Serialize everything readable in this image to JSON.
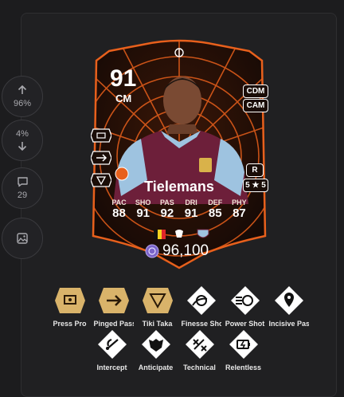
{
  "sidebar": {
    "upvote": {
      "icon": "arrow-up-icon",
      "value": "96%"
    },
    "downvote": {
      "icon": "arrow-down-icon",
      "value": "4%"
    },
    "comments": {
      "icon": "comment-icon",
      "value": "29"
    },
    "save_image": {
      "icon": "image-download-icon"
    }
  },
  "card": {
    "rating": "91",
    "position": "CM",
    "alt_positions": [
      "CDM",
      "CAM"
    ],
    "player_name": "Tielemans",
    "foot": "R",
    "skills_weak": "5 ★ 5",
    "stats": [
      {
        "label": "PAC",
        "value": "88"
      },
      {
        "label": "SHO",
        "value": "91"
      },
      {
        "label": "PAS",
        "value": "92"
      },
      {
        "label": "DRI",
        "value": "91"
      },
      {
        "label": "DEF",
        "value": "85"
      },
      {
        "label": "PHY",
        "value": "87"
      }
    ],
    "price": "96,100",
    "colors": {
      "accent": "#e8601c",
      "card_bg": "#170a05",
      "kit": "#6d1f3a"
    }
  },
  "playstyles": [
    {
      "label": "Press Pro",
      "icon": "press-proven-icon",
      "plus": true
    },
    {
      "label": "Pinged Pass",
      "icon": "pinged-pass-icon",
      "plus": true
    },
    {
      "label": "Tiki Taka",
      "icon": "tiki-taka-icon",
      "plus": true
    },
    {
      "label": "Finesse Shot",
      "icon": "finesse-shot-icon",
      "plus": false
    },
    {
      "label": "Power Shot",
      "icon": "power-shot-icon",
      "plus": false
    },
    {
      "label": "Incisive Pass",
      "icon": "incisive-pass-icon",
      "plus": false
    },
    {
      "label": "Intercept",
      "icon": "intercept-icon",
      "plus": false
    },
    {
      "label": "Anticipate",
      "icon": "anticipate-icon",
      "plus": false
    },
    {
      "label": "Technical",
      "icon": "technical-icon",
      "plus": false
    },
    {
      "label": "Relentless",
      "icon": "relentless-icon",
      "plus": false
    }
  ]
}
